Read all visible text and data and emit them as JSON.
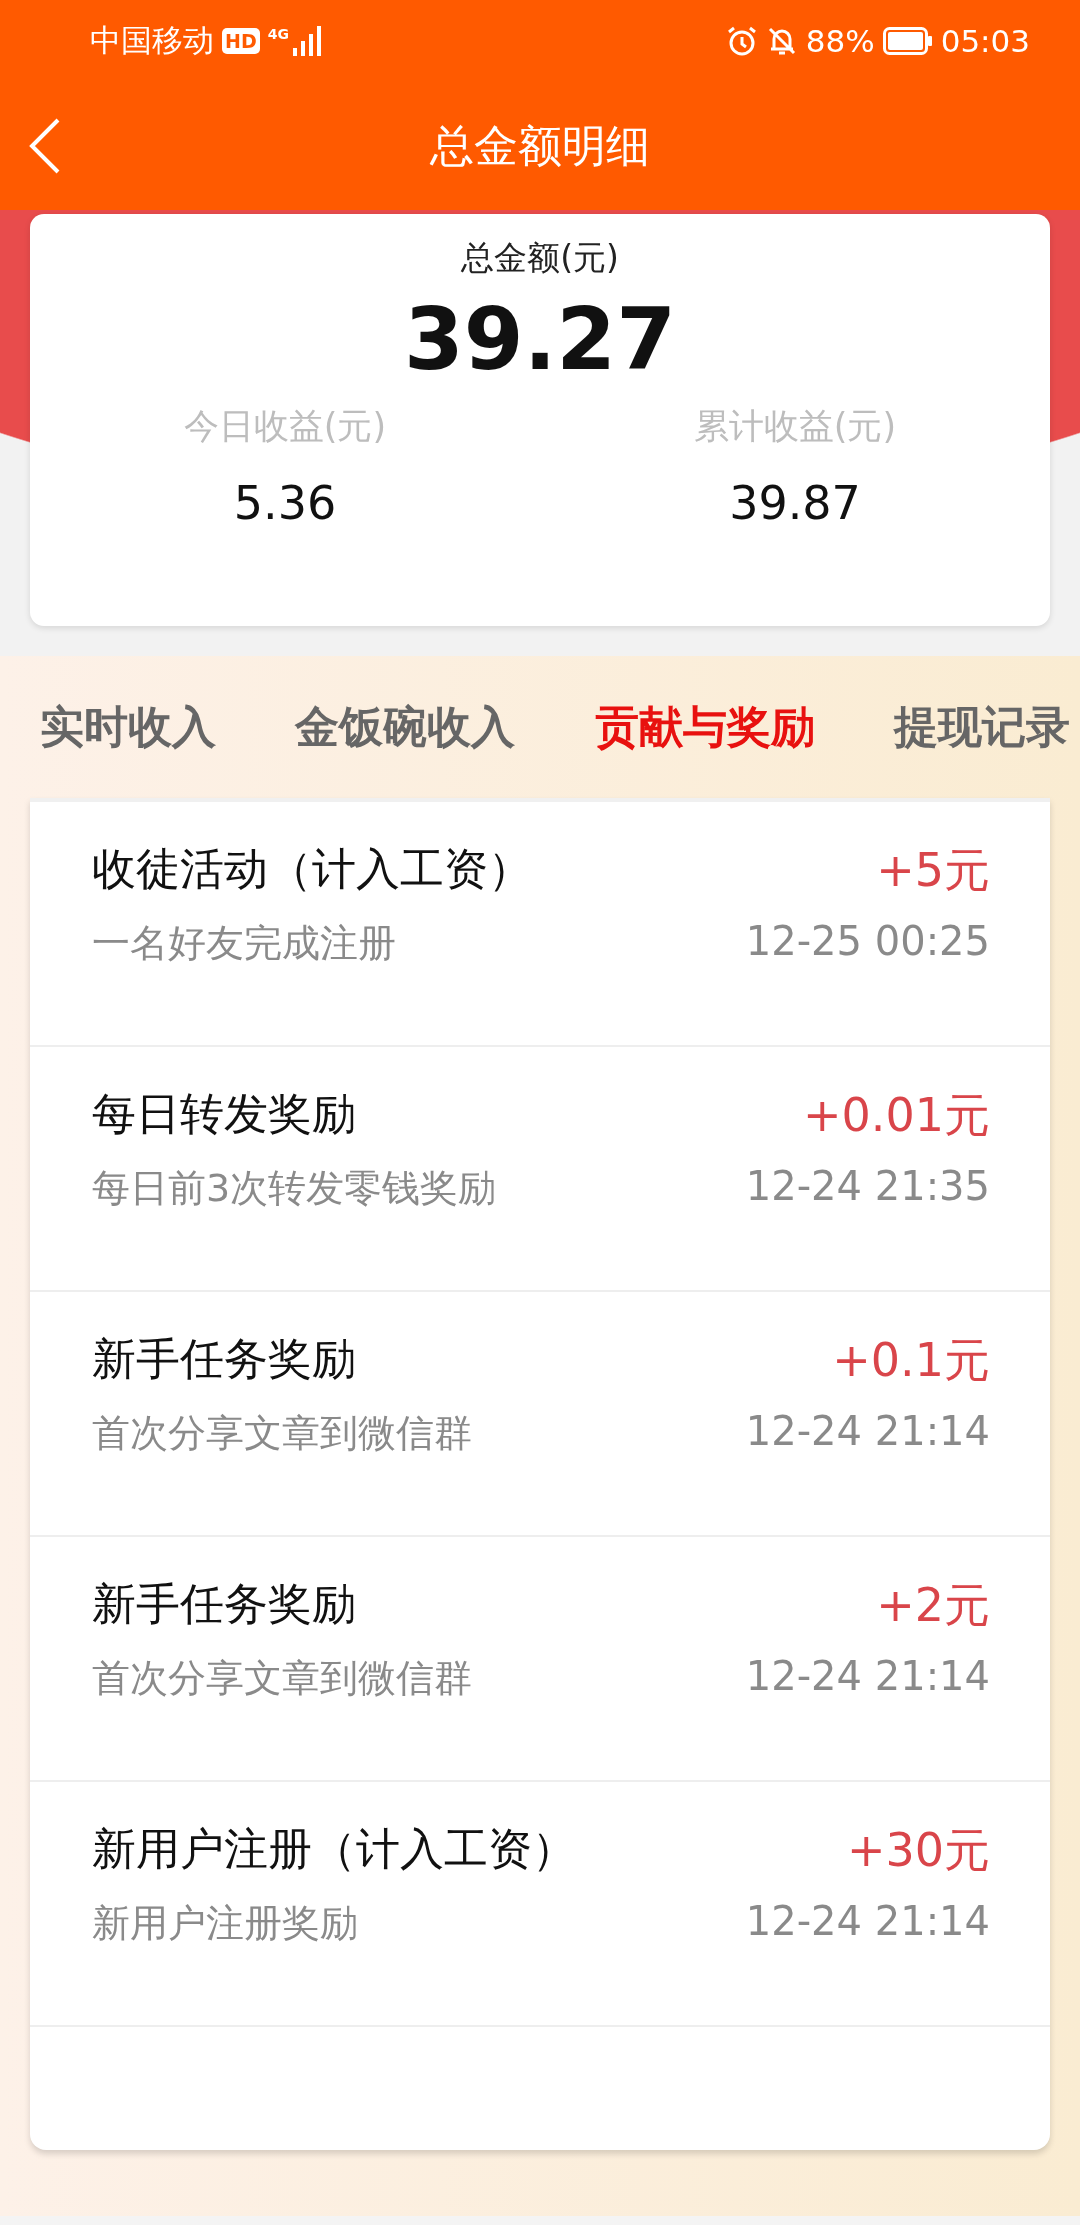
{
  "status_bar": {
    "carrier": "中国移动",
    "hd": "HD",
    "network": "4G",
    "battery": "88%",
    "time": "05:03"
  },
  "header": {
    "title": "总金额明细"
  },
  "summary": {
    "label": "总金额(元)",
    "total": "39.27",
    "stats": [
      {
        "label": "今日收益(元)",
        "value": "5.36"
      },
      {
        "label": "累计收益(元)",
        "value": "39.87"
      }
    ]
  },
  "tabs": [
    {
      "label": "实时收入",
      "selected": false
    },
    {
      "label": "金饭碗收入",
      "selected": false
    },
    {
      "label": "贡献与奖励",
      "selected": true
    },
    {
      "label": "提现记录",
      "selected": false
    }
  ],
  "records": [
    {
      "title": "收徒活动（计入工资）",
      "note": "一名好友完成注册",
      "amount": "+5元",
      "time": "12-25 00:25"
    },
    {
      "title": "每日转发奖励",
      "note": "每日前3次转发零钱奖励",
      "amount": "+0.01元",
      "time": "12-24 21:35"
    },
    {
      "title": "新手任务奖励",
      "note": "首次分享文章到微信群",
      "amount": "+0.1元",
      "time": "12-24 21:14"
    },
    {
      "title": "新手任务奖励",
      "note": "首次分享文章到微信群",
      "amount": "+2元",
      "time": "12-24 21:14"
    },
    {
      "title": "新用户注册（计入工资）",
      "note": "新用户注册奖励",
      "amount": "+30元",
      "time": "12-24 21:14"
    }
  ]
}
